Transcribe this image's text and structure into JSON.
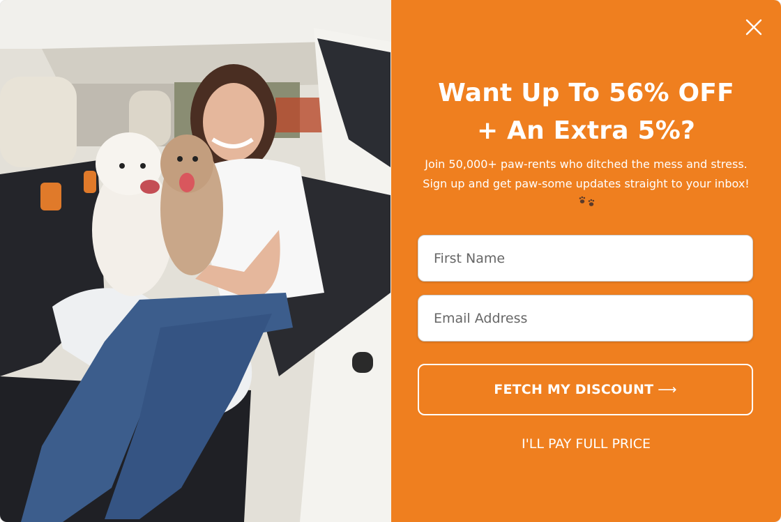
{
  "popup": {
    "headline_line1": "Want Up To 56% OFF",
    "headline_line2": "+ An Extra 5%?",
    "subtext": "Join 50,000+ paw-rents who ditched the mess and stress. Sign up and get paw-some updates straight to your inbox!",
    "paw_icon": "paw-prints-icon",
    "close_icon": "close-icon",
    "first_name_placeholder": "First Name",
    "email_placeholder": "Email Address",
    "cta_label": "FETCH MY DISCOUNT",
    "cta_arrow": "⟶",
    "decline_label": "I'LL PAY FULL PRICE"
  },
  "colors": {
    "accent": "#EF7F1F",
    "text": "#FFFFFF"
  },
  "photo": {
    "subject": "woman with two dogs on a car back seat cover"
  }
}
